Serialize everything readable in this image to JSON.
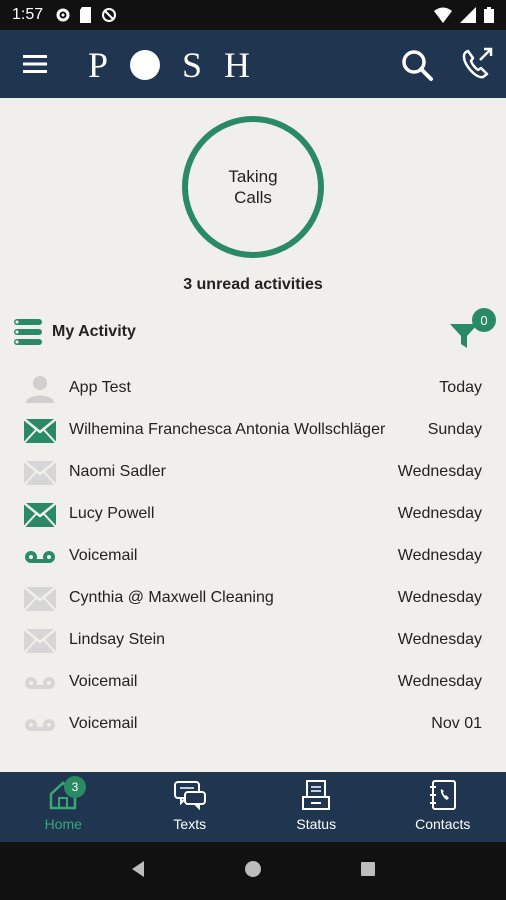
{
  "status_bar": {
    "time": "1:57"
  },
  "app": {
    "logo_left": "P",
    "logo_right": "SH"
  },
  "availability": {
    "line1": "Taking",
    "line2": "Calls"
  },
  "unread_text": "3 unread activities",
  "activity": {
    "title": "My Activity",
    "filter_count": "0",
    "items": [
      {
        "name": "App Test",
        "date": "Today",
        "type": "person",
        "unread": false
      },
      {
        "name": "Wilhemina Franchesca Antonia Wollschläger",
        "date": "Sunday",
        "type": "message",
        "unread": true
      },
      {
        "name": "Naomi Sadler",
        "date": "Wednesday",
        "type": "message",
        "unread": false
      },
      {
        "name": "Lucy Powell",
        "date": "Wednesday",
        "type": "message",
        "unread": true
      },
      {
        "name": "Voicemail",
        "date": "Wednesday",
        "type": "voicemail",
        "unread": true
      },
      {
        "name": "Cynthia @ Maxwell Cleaning",
        "date": "Wednesday",
        "type": "message",
        "unread": false
      },
      {
        "name": "Lindsay Stein",
        "date": "Wednesday",
        "type": "message",
        "unread": false
      },
      {
        "name": "Voicemail",
        "date": "Wednesday",
        "type": "voicemail",
        "unread": false
      },
      {
        "name": "Voicemail",
        "date": "Nov 01",
        "type": "voicemail",
        "unread": false
      }
    ]
  },
  "bottom_nav": {
    "home": "Home",
    "home_badge": "3",
    "texts": "Texts",
    "status": "Status",
    "contacts": "Contacts"
  },
  "colors": {
    "accent": "#2a8a64",
    "navy": "#1f3550",
    "muted_icon": "#cfcfcf"
  }
}
